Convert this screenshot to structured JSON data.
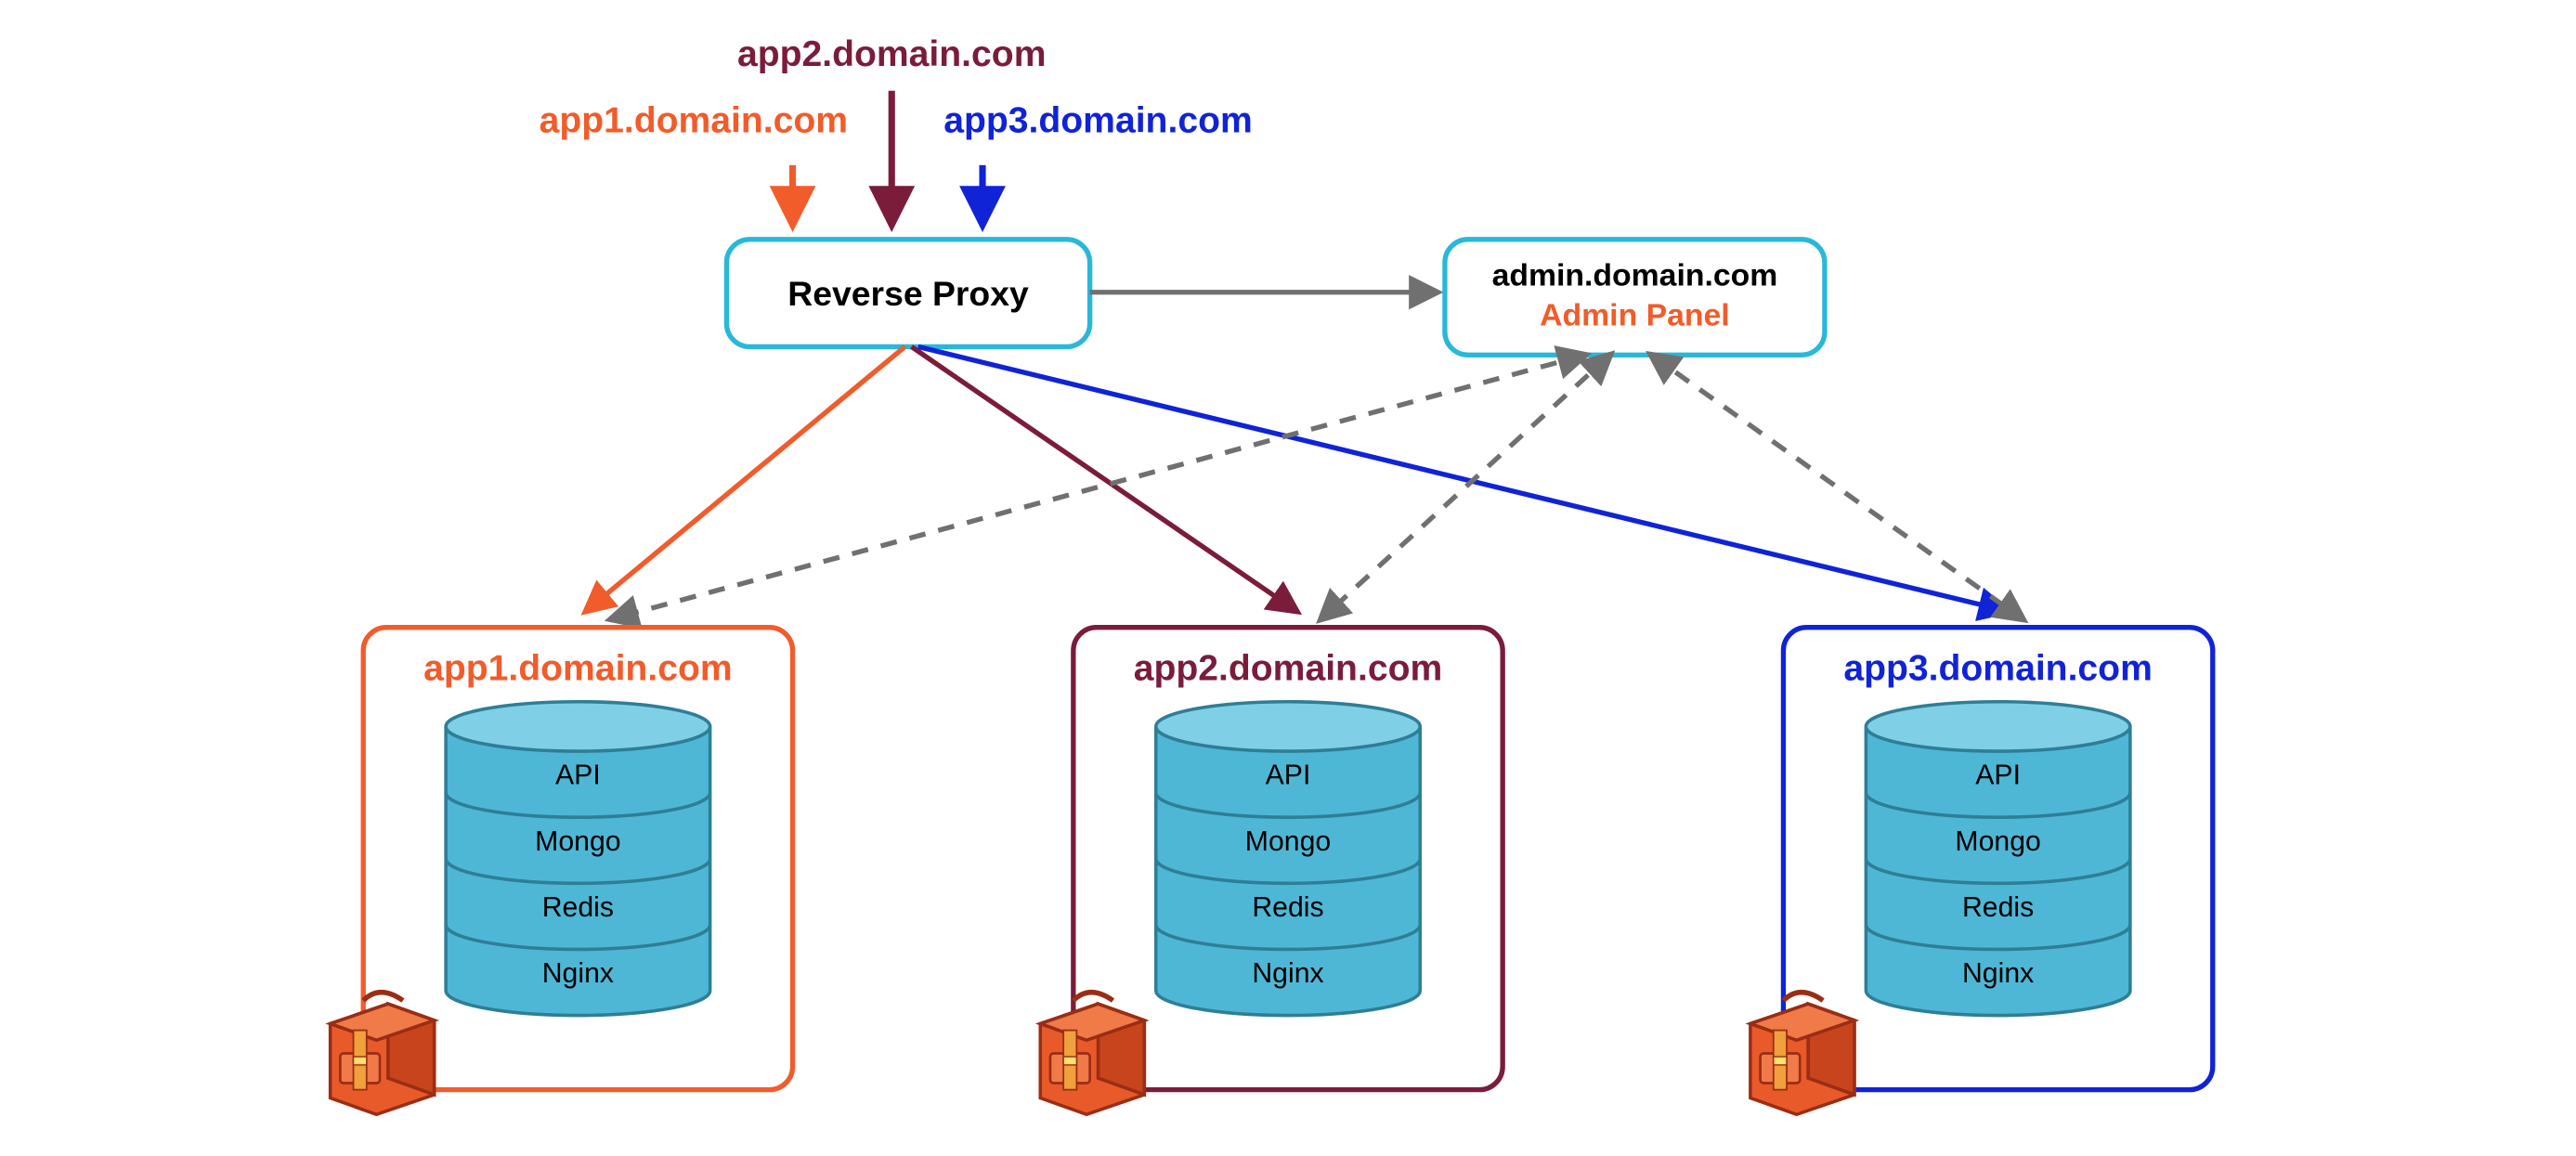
{
  "colors": {
    "cyan": "#29b8d8",
    "orange": "#f25b2a",
    "maroon": "#7a1c3a",
    "blue": "#1023d6",
    "gray": "#707070",
    "cylFill": "#4fb7d6",
    "cylStroke": "#2e7e96",
    "bagBody": "#e85a2a",
    "bagDark": "#9a2d14",
    "bagStrap": "#f0a03c"
  },
  "incoming": {
    "app1": "app1.domain.com",
    "app2": "app2.domain.com",
    "app3": "app3.domain.com"
  },
  "proxy": {
    "label": "Reverse Proxy"
  },
  "admin": {
    "domain": "admin.domain.com",
    "label": "Admin Panel"
  },
  "stack": {
    "layers": [
      "API",
      "Mongo",
      "Redis",
      "Nginx"
    ]
  },
  "apps": [
    {
      "title": "app1.domain.com",
      "colorKey": "orange"
    },
    {
      "title": "app2.domain.com",
      "colorKey": "maroon"
    },
    {
      "title": "app3.domain.com",
      "colorKey": "blue"
    }
  ]
}
